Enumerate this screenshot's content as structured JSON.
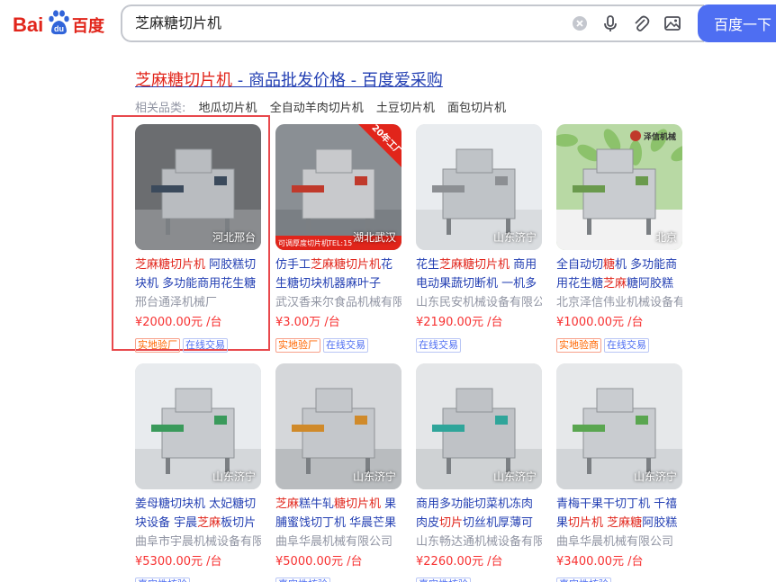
{
  "header": {
    "logo_text_1": "Bai",
    "logo_text_2": "du",
    "logo_text_3": "百度",
    "query": "芝麻糖切片机",
    "search_button": "百度一下"
  },
  "result": {
    "title_hl": "芝麻糖切片机",
    "title_rest": " - 商品批发价格 - 百度爱采购",
    "related_label": "相关品类:",
    "related_links": [
      "地瓜切片机",
      "全自动羊肉切片机",
      "土豆切片机",
      "面包切片机"
    ]
  },
  "cards": [
    {
      "loc": "河北邢台",
      "title": [
        {
          "t": "芝麻糖切片机",
          "h": true
        },
        {
          "t": " 阿胶糕切块机 多功能商用花生糖切片机",
          "h": false
        }
      ],
      "seller": "邢台通泽机械厂",
      "price": "¥2000.00元 /台",
      "badges": [
        {
          "t": "实地验厂",
          "c": "orange"
        },
        {
          "t": "在线交易",
          "c": "blue"
        }
      ]
    },
    {
      "loc": "湖北武汉",
      "banner": "20年工厂",
      "strip": "可调厚度切片机",
      "tel": "TEL:15",
      "title": [
        {
          "t": "仿手工",
          "h": false
        },
        {
          "t": "芝麻糖切片机",
          "h": true
        },
        {
          "t": "花生糖切块机器麻叶子",
          "h": false
        }
      ],
      "seller": "武汉香来尔食品机械有限公司",
      "price": "¥3.00万 /台",
      "badges": [
        {
          "t": "实地验厂",
          "c": "orange"
        },
        {
          "t": "在线交易",
          "c": "blue"
        }
      ]
    },
    {
      "loc": "山东济宁",
      "title": [
        {
          "t": "花生",
          "h": false
        },
        {
          "t": "芝麻糖切片机",
          "h": true
        },
        {
          "t": " 商用电动果蔬切断机 一机多用",
          "h": false
        }
      ],
      "seller": "山东民安机械设备有限公司",
      "price": "¥2190.00元 /台",
      "badges": [
        {
          "t": "在线交易",
          "c": "blue"
        }
      ]
    },
    {
      "loc": "北京",
      "brand": "泽信机械",
      "title": [
        {
          "t": "全自动切",
          "h": false
        },
        {
          "t": "糖",
          "h": true
        },
        {
          "t": "机 多功能商用花生糖",
          "h": false
        },
        {
          "t": "芝麻",
          "h": true
        },
        {
          "t": "糖阿胶糕切块机",
          "h": false
        }
      ],
      "seller": "北京泽信伟业机械设备有限公司",
      "price": "¥1000.00元 /台",
      "badges": [
        {
          "t": "实地验商",
          "c": "orange"
        },
        {
          "t": "在线交易",
          "c": "blue"
        }
      ]
    },
    {
      "loc": "山东济宁",
      "title": [
        {
          "t": "姜母糖切块机 太妃糖切块设备 宇晨",
          "h": false
        },
        {
          "t": "芝麻",
          "h": true
        },
        {
          "t": "板切片机",
          "h": false
        }
      ],
      "seller": "曲阜市宇晨机械设备有限公司",
      "price": "¥5300.00元 /台",
      "badges": [
        {
          "t": "真实性核验",
          "c": "blue"
        }
      ]
    },
    {
      "loc": "山东济宁",
      "title": [
        {
          "t": "芝麻",
          "h": true
        },
        {
          "t": "糕牛轧",
          "h": false
        },
        {
          "t": "糖切片机",
          "h": true
        },
        {
          "t": " 果脯蜜饯切丁机 华晨芒果切丁机",
          "h": false
        }
      ],
      "seller": "曲阜华晨机械有限公司",
      "price": "¥5000.00元 /台",
      "badges": [
        {
          "t": "真实性核验",
          "c": "blue"
        }
      ]
    },
    {
      "loc": "山东济宁",
      "title": [
        {
          "t": "商用多功能切菜机冻肉肉皮",
          "h": false
        },
        {
          "t": "切片",
          "h": true
        },
        {
          "t": "切丝机厚薄可调",
          "h": false
        }
      ],
      "seller": "山东畅达通机械设备有限公司",
      "price": "¥2260.00元 /台",
      "badges": [
        {
          "t": "真实性核验",
          "c": "blue"
        }
      ]
    },
    {
      "loc": "山东济宁",
      "title": [
        {
          "t": "青梅干果干切丁机 千禧果",
          "h": false
        },
        {
          "t": "切片机",
          "h": true
        },
        {
          "t": " ",
          "h": false
        },
        {
          "t": "芝麻糖",
          "h": true
        },
        {
          "t": "阿胶糕切块机",
          "h": false
        }
      ],
      "seller": "曲阜华晨机械有限公司",
      "price": "¥3400.00元 /台",
      "badges": [
        {
          "t": "真实性核验",
          "c": "blue"
        }
      ]
    }
  ]
}
